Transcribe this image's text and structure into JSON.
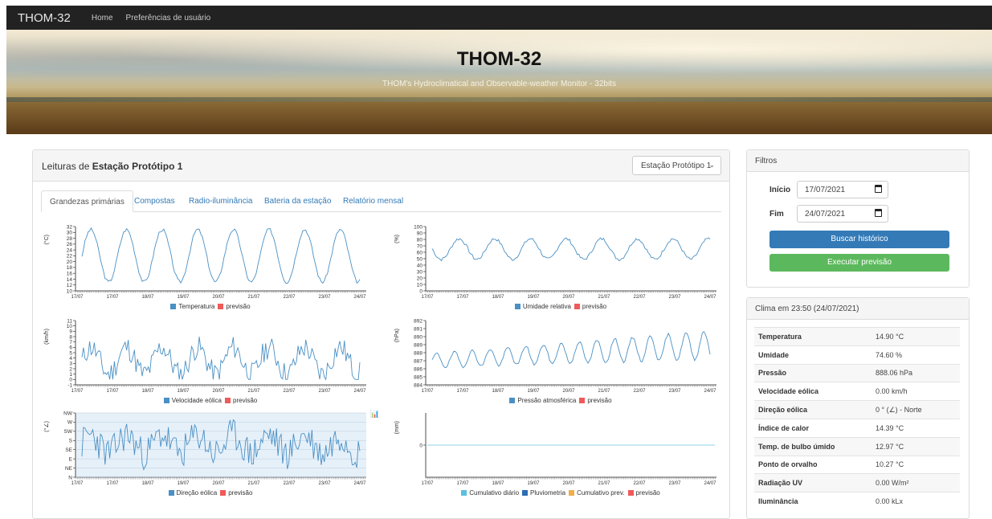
{
  "navbar": {
    "brand": "THOM-32",
    "links": [
      "Home",
      "Preferências de usuário"
    ]
  },
  "hero": {
    "title": "THOM-32",
    "subtitle": "THOM's Hydroclimatical and Observable-weather Monitor - 32bits"
  },
  "main": {
    "title_prefix": "Leituras de ",
    "station_name": "Estação Protótipo 1",
    "station_select": "Estação Protótipo 1",
    "tabs": [
      "Grandezas primárias",
      "Compostas",
      "Radio-iluminância",
      "Bateria da estação",
      "Relatório mensal"
    ]
  },
  "colors": {
    "line": "#4a90c4",
    "forecast": "#f05a5a",
    "rain_daily": "#5bc0de",
    "pluvio": "#2e6db4",
    "cumul_prev": "#f0ad4e"
  },
  "chart_data": [
    {
      "type": "line",
      "ylabel": "(°C)",
      "yticks": [
        10,
        12,
        14,
        16,
        18,
        20,
        22,
        24,
        26,
        28,
        30,
        32
      ],
      "ylim": [
        10,
        32
      ],
      "xticks": [
        "17/07",
        "17/07",
        "18/07",
        "19/07",
        "20/07",
        "21/07",
        "22/07",
        "23/07",
        "24/07"
      ],
      "series": [
        {
          "name": "Temperatura"
        },
        {
          "name": "previsão"
        }
      ],
      "shape": {
        "kind": "daily",
        "base": 22,
        "amp": 9,
        "noise": 1.2,
        "seed": 3
      }
    },
    {
      "type": "line",
      "ylabel": "(%)",
      "yticks": [
        0,
        10,
        20,
        30,
        40,
        50,
        60,
        70,
        80,
        90,
        100
      ],
      "ylim": [
        0,
        100
      ],
      "xticks": [
        "17/07",
        "17/07",
        "18/07",
        "19/07",
        "20/07",
        "21/07",
        "22/07",
        "23/07",
        "24/07"
      ],
      "series": [
        {
          "name": "Umidade relativa"
        },
        {
          "name": "previsão"
        }
      ],
      "shape": {
        "kind": "daily",
        "base": 65,
        "amp": 16,
        "noise": 5,
        "seed": 7,
        "phase": 3.1
      }
    },
    {
      "type": "line",
      "ylabel": "(km/h)",
      "yticks": [
        -1,
        0,
        1,
        2,
        3,
        4,
        5,
        6,
        7,
        8,
        9,
        10,
        11
      ],
      "ylim": [
        -1,
        11
      ],
      "xticks": [
        "17/07",
        "17/07",
        "18/07",
        "19/07",
        "20/07",
        "21/07",
        "22/07",
        "23/07",
        "24/07"
      ],
      "series": [
        {
          "name": "Velocidade eólica"
        },
        {
          "name": "previsão"
        }
      ],
      "shape": {
        "kind": "noisy",
        "base": 3.5,
        "amp": 2.5,
        "noise": 2.2,
        "seed": 11,
        "min": 0
      }
    },
    {
      "type": "line",
      "ylabel": "(hPa)",
      "yticks": [
        884,
        885,
        886,
        887,
        888,
        889,
        890,
        891,
        892
      ],
      "ylim": [
        884,
        892
      ],
      "xticks": [
        "17/07",
        "17/07",
        "18/07",
        "19/07",
        "20/07",
        "21/07",
        "22/07",
        "23/07",
        "24/07"
      ],
      "series": [
        {
          "name": "Pressão atmosférica"
        },
        {
          "name": "previsão"
        }
      ],
      "shape": {
        "kind": "pressure",
        "base": 887,
        "amp": 1.4,
        "noise": 0.3,
        "seed": 19
      }
    },
    {
      "type": "line",
      "ylabel": "(°∠)",
      "yticks": [
        "N",
        "NE",
        "E",
        "SE",
        "S",
        "SW",
        "W",
        "NW"
      ],
      "ylim": [
        0,
        7
      ],
      "xticks": [
        "17/07",
        "17/07",
        "18/07",
        "19/07",
        "20/07",
        "21/07",
        "22/07",
        "23/07",
        "24/07"
      ],
      "series": [
        {
          "name": "Direção eólica"
        },
        {
          "name": "previsão"
        }
      ],
      "shape": {
        "kind": "noisy",
        "base": 3.6,
        "amp": 1,
        "noise": 1.8,
        "seed": 23,
        "min": 0.2,
        "max": 6.8
      }
    },
    {
      "type": "line",
      "ylabel": "(mm)",
      "yticks": [
        0
      ],
      "ylim": [
        -1,
        1
      ],
      "xticks": [
        "17/07",
        "17/07",
        "18/07",
        "19/07",
        "20/07",
        "21/07",
        "22/07",
        "23/07",
        "24/07"
      ],
      "series": [
        {
          "name": "Cumulativo diário"
        },
        {
          "name": "Pluviometria"
        },
        {
          "name": "Cumulativo prev."
        },
        {
          "name": "previsão"
        }
      ],
      "shape": {
        "kind": "flat",
        "value": 0
      }
    }
  ],
  "filters": {
    "title": "Filtros",
    "start_label": "Início",
    "start_value": "17/07/2021",
    "end_label": "Fim",
    "end_value": "24/07/2021",
    "search_button": "Buscar histórico",
    "forecast_button": "Executar previsão"
  },
  "climate": {
    "title": "Clima em 23:50 (24/07/2021)",
    "rows": [
      {
        "label": "Temperatura",
        "value": "14.90 °C"
      },
      {
        "label": "Umidade",
        "value": "74.60 %"
      },
      {
        "label": "Pressão",
        "value": "888.06 hPa"
      },
      {
        "label": "Velocidade eólica",
        "value": "0.00 km/h"
      },
      {
        "label": "Direção eólica",
        "value": "0 ° (∠) - Norte"
      },
      {
        "label": "Índice de calor",
        "value": "14.39 °C"
      },
      {
        "label": "Temp. de bulbo úmido",
        "value": "12.97 °C"
      },
      {
        "label": "Ponto de orvalho",
        "value": "10.27 °C"
      },
      {
        "label": "Radiação UV",
        "value": "0.00 W/m²"
      },
      {
        "label": "Iluminância",
        "value": "0.00 kLx"
      }
    ]
  }
}
